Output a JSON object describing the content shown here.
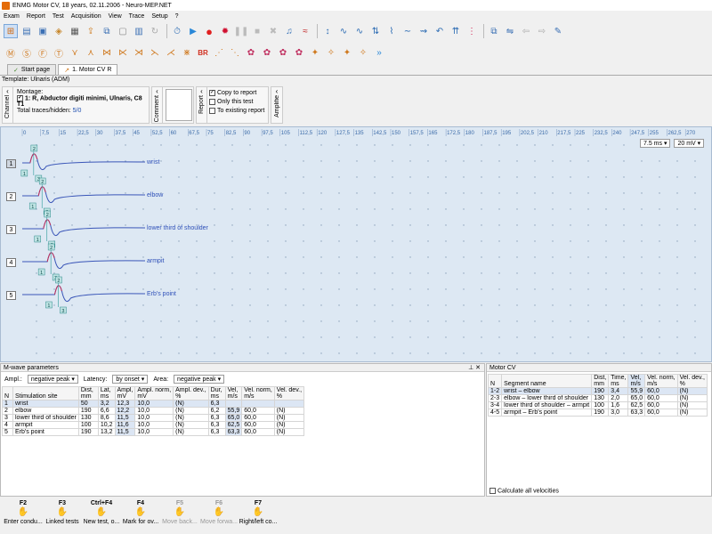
{
  "window": {
    "title": "ENMG Motor CV, 18 years, 02.11.2006 - Neuro-MEP.NET"
  },
  "menu": [
    "Exam",
    "Report",
    "Test",
    "Acquisition",
    "View",
    "Trace",
    "Setup",
    "?"
  ],
  "tabs": [
    {
      "label": "Start page"
    },
    {
      "label": "1. Motor CV R"
    }
  ],
  "template": "Template: Ulnaris (ADM)",
  "channel": {
    "label": "Channel",
    "montage_label": "Montage:",
    "montage": "1: R, Abductor digiti minimi, Ulnaris, C8 T1",
    "traces_label": "Total traces/hidden:",
    "traces_value": "5/0"
  },
  "comment_label": "Comment",
  "report": {
    "label": "Report",
    "copy_to_report": "Copy to report",
    "only_this_test": "Only this test",
    "to_existing": "To existing report"
  },
  "amplifier_label": "Amplifie",
  "chart": {
    "x_ticks": [
      "0",
      "7,5",
      "15",
      "22,5",
      "30",
      "37,5",
      "45",
      "52,5",
      "60",
      "67,5",
      "75",
      "82,5",
      "90",
      "97,5",
      "105",
      "112,5",
      "120",
      "127,5",
      "135",
      "142,5",
      "150",
      "157,5",
      "165",
      "172,5",
      "180",
      "187,5",
      "195",
      "202,5",
      "210",
      "217,5",
      "225",
      "232,5",
      "240",
      "247,5",
      "255",
      "262,5",
      "270"
    ],
    "sweep": "7.5 ms",
    "gain": "20 mV",
    "traces": [
      {
        "n": "1",
        "label": "wrist"
      },
      {
        "n": "2",
        "label": "elbow"
      },
      {
        "n": "3",
        "label": "lower third of shoulder"
      },
      {
        "n": "4",
        "label": "armpit"
      },
      {
        "n": "5",
        "label": "Erb's point"
      }
    ]
  },
  "mwave": {
    "title": "M-wave parameters",
    "ampl_label": "Ampl.:",
    "ampl_value": "negative peak",
    "latency_label": "Latency:",
    "latency_value": "by onset",
    "area_label": "Area:",
    "area_value": "negative peak",
    "headers": [
      "N",
      "Stimulation site",
      "Dist, mm",
      "Lat, ms",
      "Ampl, mV",
      "Ampl. norm, mV",
      "Ampl. dev., %",
      "Dur, ms",
      "Vel, m/s",
      "Vel. norm, m/s",
      "Vel. dev., %"
    ],
    "rows": [
      [
        "1",
        "wrist",
        "50",
        "3,2",
        "12,3",
        "10,0",
        "(N)",
        "6,3",
        "",
        "",
        ""
      ],
      [
        "2",
        "elbow",
        "190",
        "6,6",
        "12,2",
        "10,0",
        "(N)",
        "6,2",
        "55,9",
        "60,0",
        "(N)"
      ],
      [
        "3",
        "lower third of shoulder",
        "130",
        "8,6",
        "11,5",
        "10,0",
        "(N)",
        "6,3",
        "65,0",
        "60,0",
        "(N)"
      ],
      [
        "4",
        "armpit",
        "100",
        "10,2",
        "11,6",
        "10,0",
        "(N)",
        "6,3",
        "62,5",
        "60,0",
        "(N)"
      ],
      [
        "5",
        "Erb's point",
        "190",
        "13,2",
        "11,5",
        "10,0",
        "(N)",
        "6,3",
        "63,3",
        "60,0",
        "(N)"
      ]
    ]
  },
  "motorcv": {
    "title": "Motor CV",
    "headers": [
      "N",
      "Segment name",
      "Dist, mm",
      "Time, ms",
      "Vel, m/s",
      "Vel. norm, m/s",
      "Vel. dev., %"
    ],
    "rows": [
      [
        "1-2",
        "wrist – elbow",
        "190",
        "3,4",
        "55,9",
        "60,0",
        "(N)"
      ],
      [
        "2-3",
        "elbow – lower third of shoulder",
        "130",
        "2,0",
        "65,0",
        "60,0",
        "(N)"
      ],
      [
        "3-4",
        "lower third of shoulder – armpit",
        "100",
        "1,6",
        "62,5",
        "60,0",
        "(N)"
      ],
      [
        "4-5",
        "armpit – Erb's point",
        "190",
        "3,0",
        "63,3",
        "60,0",
        "(N)"
      ]
    ],
    "calc_all": "Calculate all velocities"
  },
  "fkeys": [
    {
      "key": "F2",
      "label": "Enter condu...",
      "icon": "conduction-icon",
      "enabled": true
    },
    {
      "key": "F3",
      "label": "Linked tests",
      "icon": "linked-tests-icon",
      "enabled": true
    },
    {
      "key": "Ctrl+F4",
      "label": "New test, o...",
      "icon": "new-test-icon",
      "enabled": true
    },
    {
      "key": "F4",
      "label": "Mark for ov...",
      "icon": "mark-icon",
      "enabled": true
    },
    {
      "key": "F5",
      "label": "Move back...",
      "icon": "move-back-icon",
      "enabled": false
    },
    {
      "key": "F6",
      "label": "Move forwa...",
      "icon": "move-forward-icon",
      "enabled": false
    },
    {
      "key": "F7",
      "label": "Right/left co...",
      "icon": "right-left-icon",
      "enabled": true
    }
  ]
}
